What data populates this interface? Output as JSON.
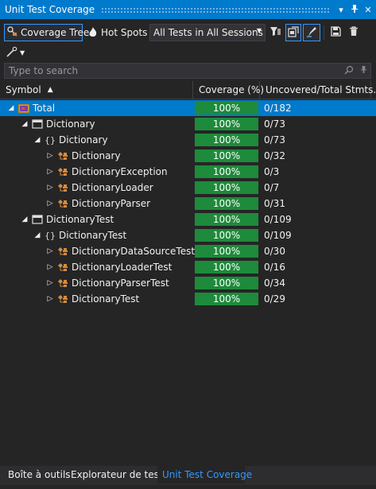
{
  "window": {
    "title": "Unit Test Coverage"
  },
  "toolbar": {
    "coverage_tree_label": "Coverage Tree",
    "hot_spots_label": "Hot Spots",
    "session_combo_value": "All Tests in All Sessions"
  },
  "search": {
    "placeholder": "Type to search"
  },
  "columns": {
    "symbol": "Symbol",
    "coverage": "Coverage (%)",
    "uncovered": "Uncovered/Total Stmts."
  },
  "rows": [
    {
      "label": "Total",
      "coverage": "100%",
      "uncovered": "0/182",
      "level": 0,
      "kind": "total",
      "expanded": true,
      "selected": true
    },
    {
      "label": "Dictionary",
      "coverage": "100%",
      "uncovered": "0/73",
      "level": 1,
      "kind": "project",
      "expanded": true
    },
    {
      "label": "Dictionary",
      "coverage": "100%",
      "uncovered": "0/73",
      "level": 2,
      "kind": "namespace",
      "expanded": true
    },
    {
      "label": "Dictionary",
      "coverage": "100%",
      "uncovered": "0/32",
      "level": 3,
      "kind": "class",
      "expanded": false
    },
    {
      "label": "DictionaryException",
      "coverage": "100%",
      "uncovered": "0/3",
      "level": 3,
      "kind": "class",
      "expanded": false
    },
    {
      "label": "DictionaryLoader",
      "coverage": "100%",
      "uncovered": "0/7",
      "level": 3,
      "kind": "class",
      "expanded": false
    },
    {
      "label": "DictionaryParser",
      "coverage": "100%",
      "uncovered": "0/31",
      "level": 3,
      "kind": "class",
      "expanded": false
    },
    {
      "label": "DictionaryTest",
      "coverage": "100%",
      "uncovered": "0/109",
      "level": 1,
      "kind": "project",
      "expanded": true
    },
    {
      "label": "DictionaryTest",
      "coverage": "100%",
      "uncovered": "0/109",
      "level": 2,
      "kind": "namespace",
      "expanded": true
    },
    {
      "label": "DictionaryDataSourceTest",
      "coverage": "100%",
      "uncovered": "0/30",
      "level": 3,
      "kind": "class",
      "expanded": false
    },
    {
      "label": "DictionaryLoaderTest",
      "coverage": "100%",
      "uncovered": "0/16",
      "level": 3,
      "kind": "class",
      "expanded": false
    },
    {
      "label": "DictionaryParserTest",
      "coverage": "100%",
      "uncovered": "0/34",
      "level": 3,
      "kind": "class",
      "expanded": false
    },
    {
      "label": "DictionaryTest",
      "coverage": "100%",
      "uncovered": "0/29",
      "level": 3,
      "kind": "class",
      "expanded": false
    }
  ],
  "bottom_tabs": [
    {
      "label": "Boîte à outils",
      "active": false
    },
    {
      "label": "Explorateur de tests",
      "active": false
    },
    {
      "label": "Unit Test Coverage",
      "active": true
    }
  ],
  "colors": {
    "accent": "#007acc",
    "coverage_green": "#1e8a3b",
    "background": "#252526"
  }
}
